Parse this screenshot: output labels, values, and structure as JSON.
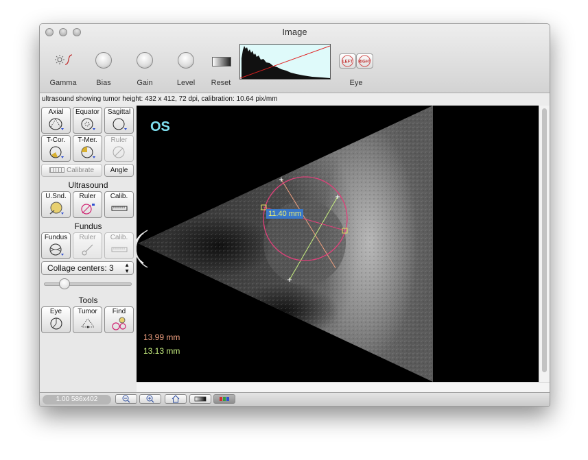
{
  "window": {
    "title": "Image"
  },
  "toolbar": {
    "items": [
      {
        "label": "Gamma",
        "icon": "gamma-icon"
      },
      {
        "label": "Bias",
        "icon": "bias-knob-icon"
      },
      {
        "label": "Gain",
        "icon": "gain-knob-icon"
      },
      {
        "label": "Level",
        "icon": "level-knob-icon"
      },
      {
        "label": "Reset",
        "icon": "reset-gradient-icon"
      }
    ],
    "eye": {
      "label": "Eye",
      "left": "LEFT",
      "right": "RIGHT"
    }
  },
  "info": {
    "text": "ultrasound showing tumor height: 432 x 412, 72 dpi, calibration: 10.64 pix/mm"
  },
  "sidebar": {
    "views": [
      {
        "label": "Axial",
        "enabled": true
      },
      {
        "label": "Equator",
        "enabled": true
      },
      {
        "label": "Sagittal",
        "enabled": true
      },
      {
        "label": "T-Cor.",
        "enabled": true
      },
      {
        "label": "T-Mer.",
        "enabled": true
      },
      {
        "label": "Ruler",
        "enabled": false
      }
    ],
    "calibrate_label": "Calibrate",
    "angle_label": "Angle",
    "ultrasound": {
      "title": "Ultrasound",
      "buttons": [
        {
          "label": "U.Snd.",
          "enabled": true
        },
        {
          "label": "Ruler",
          "enabled": true
        },
        {
          "label": "Calib.",
          "enabled": true
        }
      ]
    },
    "fundus": {
      "title": "Fundus",
      "buttons": [
        {
          "label": "Fundus",
          "enabled": true
        },
        {
          "label": "Ruler",
          "enabled": false
        },
        {
          "label": "Calib.",
          "enabled": false
        }
      ]
    },
    "collage": {
      "label": "Collage centers: 3"
    },
    "slider": {
      "value": 0.2
    },
    "tools": {
      "title": "Tools",
      "buttons": [
        {
          "label": "Eye"
        },
        {
          "label": "Tumor"
        },
        {
          "label": "Find"
        }
      ]
    }
  },
  "viewer": {
    "eye_label": "OS",
    "measure_label": "11.40 mm",
    "measurement_1": "13.99 mm",
    "measurement_2": "13.13 mm",
    "colors": {
      "eye_label": "#7fe0f0",
      "circle": "#e0407a",
      "line_1": "#f0a080",
      "line_2": "#c8f080",
      "measure_bg": "#3a78c8",
      "measure_text": "#f0f070",
      "measurement_1": "#f0a080",
      "measurement_2": "#c8f080"
    }
  },
  "bottom": {
    "zoom_label": "1.00 586x402"
  }
}
